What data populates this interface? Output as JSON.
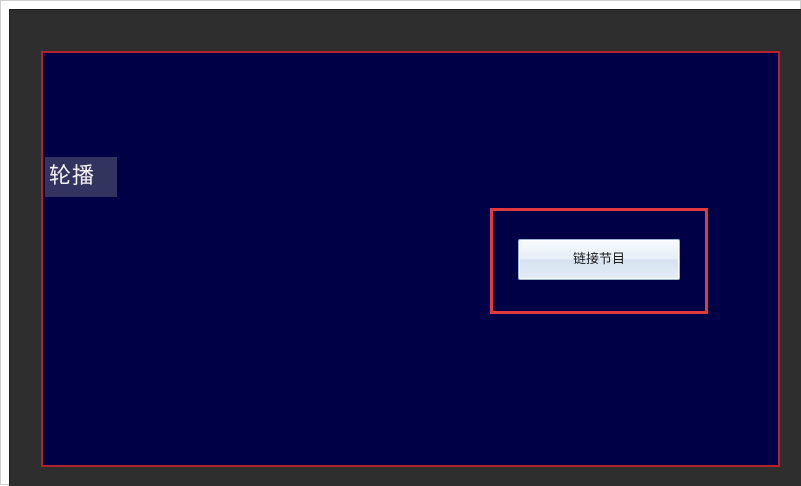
{
  "canvas": {
    "carousel_label": "轮播"
  },
  "actions": {
    "link_program_label": "链接节目"
  },
  "colors": {
    "stage_background": "#000046",
    "stage_border": "#b3222a",
    "highlight_border": "#e03a3e",
    "workspace_background": "#2e2e2e"
  }
}
